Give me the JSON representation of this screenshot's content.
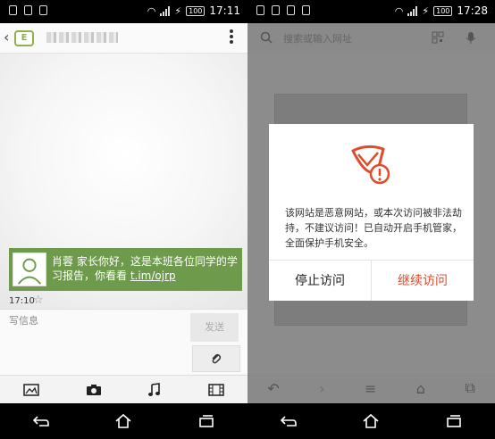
{
  "left": {
    "status": {
      "time": "17:11",
      "battery": "100"
    },
    "toolbar": {
      "contact_letter": "E",
      "menu_icon": "more-vert-icon"
    },
    "message": {
      "text": "肖蓉 家长你好，这是本班各位同学的学习报告，你看看 ",
      "link": "t.im/ojrp",
      "time": "17:10"
    },
    "compose": {
      "placeholder": "写信息",
      "send_label": "发送"
    },
    "media_icons": [
      "gallery-icon",
      "camera-icon",
      "music-icon",
      "video-icon"
    ]
  },
  "right": {
    "status": {
      "time": "17:28",
      "battery": "100"
    },
    "search": {
      "placeholder": "搜索或输入网址"
    },
    "dialog": {
      "message": "该网站是恶意网站，或本次访问被非法劫持，不建议访问！已自动开启手机管家，全面保护手机安全。",
      "stop_label": "停止访问",
      "continue_label": "继续访问",
      "accent": "#e04b2c"
    }
  },
  "nav_icons": [
    "back-icon",
    "home-icon",
    "recents-icon"
  ]
}
